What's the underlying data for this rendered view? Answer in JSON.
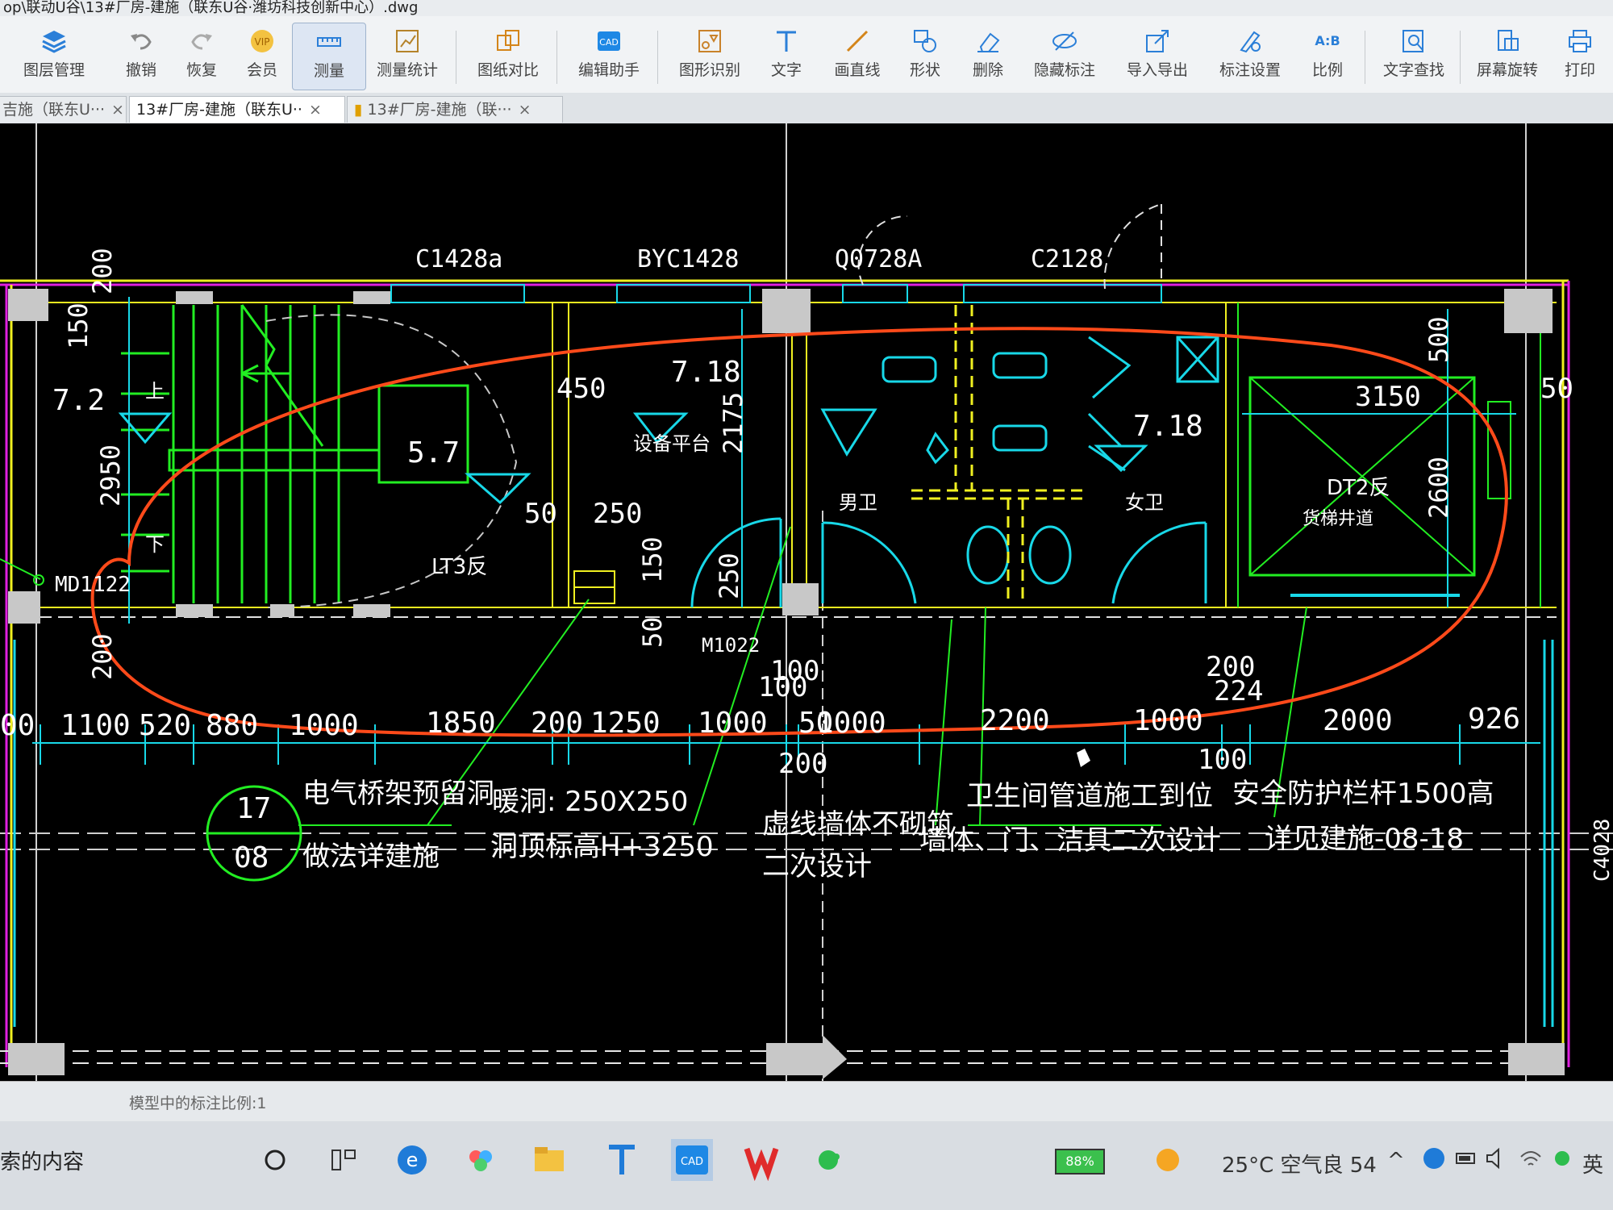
{
  "window": {
    "title": "op\\联动U谷\\13#厂房-建施（联东U谷·潍坊科技创新中心）.dwg"
  },
  "toolbar": {
    "items": [
      {
        "label": "图层管理",
        "icon": "layers-icon"
      },
      {
        "label": "撤销",
        "icon": "undo-icon"
      },
      {
        "label": "恢复",
        "icon": "redo-icon"
      },
      {
        "label": "会员",
        "icon": "vip-icon"
      },
      {
        "label": "测量",
        "icon": "measure-icon"
      },
      {
        "label": "测量统计",
        "icon": "measure-stats-icon"
      },
      {
        "label": "图纸对比",
        "icon": "compare-icon"
      },
      {
        "label": "编辑助手",
        "icon": "edit-assistant-icon"
      },
      {
        "label": "图形识别",
        "icon": "shape-recognize-icon"
      },
      {
        "label": "文字",
        "icon": "text-icon"
      },
      {
        "label": "画直线",
        "icon": "line-icon"
      },
      {
        "label": "形状",
        "icon": "shape-icon"
      },
      {
        "label": "删除",
        "icon": "eraser-icon"
      },
      {
        "label": "隐藏标注",
        "icon": "hide-annotation-icon"
      },
      {
        "label": "导入导出",
        "icon": "import-export-icon"
      },
      {
        "label": "标注设置",
        "icon": "annotation-settings-icon"
      },
      {
        "label": "比例",
        "icon": "scale-icon"
      },
      {
        "label": "文字查找",
        "icon": "text-search-icon"
      },
      {
        "label": "屏幕旋转",
        "icon": "rotate-screen-icon"
      },
      {
        "label": "打印",
        "icon": "print-icon"
      }
    ],
    "ratio_glyph": "A:B"
  },
  "tabs": [
    {
      "label": "吉施（联东U···",
      "close": "×"
    },
    {
      "label": "13#厂房-建施（联东U··",
      "close": "×"
    },
    {
      "label": "13#厂房-建施（联···",
      "close": "×"
    }
  ],
  "drawing": {
    "windows": [
      "C1428a",
      "BYC1428",
      "Q0728A",
      "C2128"
    ],
    "rooms": {
      "equipment": "设备平台",
      "men": "男卫",
      "women": "女卫",
      "shaft": "DT2反",
      "shaft_sub": "货梯井道",
      "stair": "LT3反",
      "stair_up": "上",
      "stair_down": "下"
    },
    "doors": [
      "MD1122",
      "M1022"
    ],
    "elevations": [
      "7.2",
      "5.7",
      "7.18",
      "7.18"
    ],
    "dims_vertical": [
      "200",
      "150",
      "2950",
      "200",
      "2175",
      "250",
      "150",
      "50",
      "250",
      "500",
      "2600"
    ],
    "dims_misc": [
      "450",
      "50",
      "250",
      "3150",
      "50",
      "100",
      "100",
      "200",
      "200",
      "224",
      "100"
    ],
    "dims_bottom": [
      "00",
      "1100",
      "520",
      "880",
      "1000",
      "1850",
      "200",
      "1250",
      "1000",
      "50",
      "1000",
      "2200",
      "1000",
      "2000",
      "926"
    ],
    "detail_ref": {
      "top": "17",
      "bottom": "08"
    },
    "notes": [
      "电气桥架预留洞",
      "做法详建施",
      "暖洞: 250X250",
      "洞顶标高H+3250",
      "虚线墙体不砌筑",
      "二次设计",
      "卫生间管道施工到位",
      "墙体、门、洁具二次设计",
      "安全防护栏杆1500高",
      "详见建施-08-18"
    ],
    "side_label": "C4028"
  },
  "statusbar": {
    "scale_text": "模型中的标注比例:1"
  },
  "taskbar": {
    "search_text": "索的内容",
    "battery": "88%",
    "weather": "25°C  空气良 54",
    "ime": "英"
  },
  "colors": {
    "accent_red": "#ff4a1a",
    "wall_green": "#22ee22",
    "cyan": "#18d8e8",
    "magenta": "#e020e0",
    "yellow": "#f0f020"
  }
}
